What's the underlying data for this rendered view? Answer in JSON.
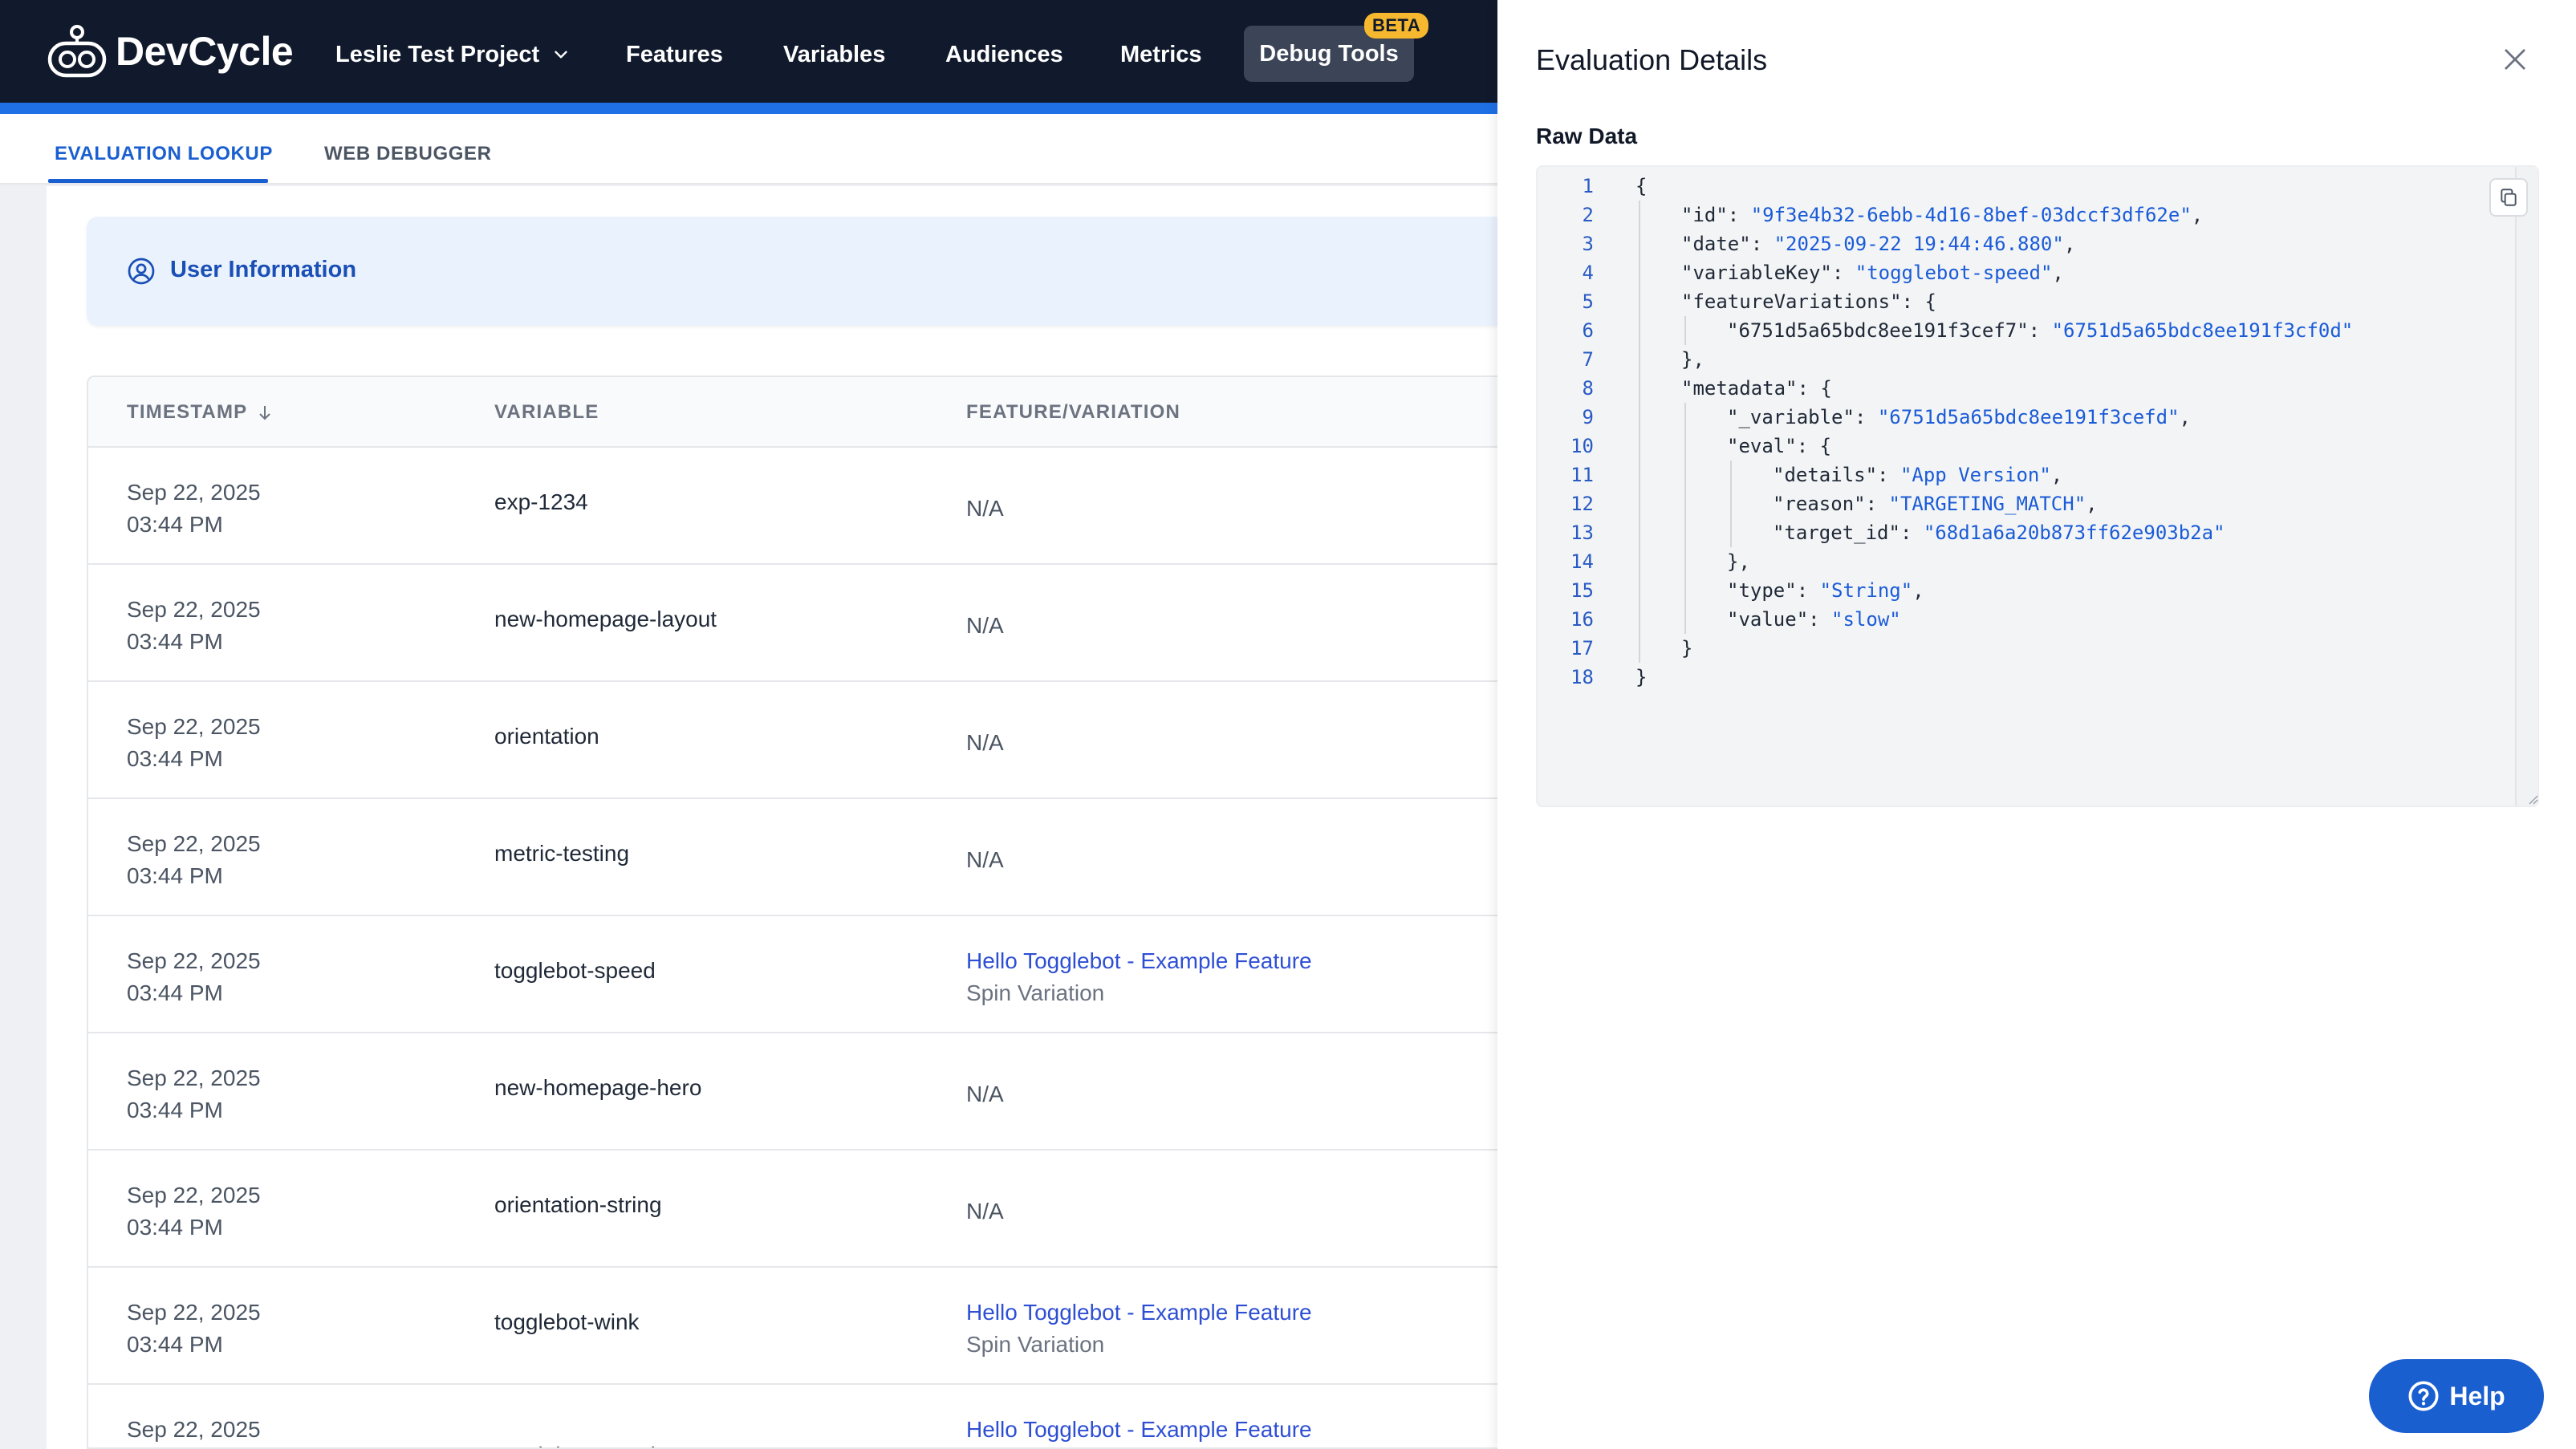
{
  "app": {
    "logo_text": "DevCycle"
  },
  "nav": {
    "project": "Leslie Test Project",
    "items": [
      "Features",
      "Variables",
      "Audiences",
      "Metrics"
    ],
    "active": "Debug Tools",
    "badge": "BETA"
  },
  "subtabs": [
    "EVALUATION LOOKUP",
    "WEB DEBUGGER"
  ],
  "user_info": {
    "label": "User Information"
  },
  "table": {
    "headers": [
      "TIMESTAMP",
      "VARIABLE",
      "FEATURE/VARIATION"
    ],
    "rows": [
      {
        "date": "Sep 22, 2025",
        "time": "03:44 PM",
        "variable": "exp-1234",
        "feature": "N/A",
        "variation": ""
      },
      {
        "date": "Sep 22, 2025",
        "time": "03:44 PM",
        "variable": "new-homepage-layout",
        "feature": "N/A",
        "variation": ""
      },
      {
        "date": "Sep 22, 2025",
        "time": "03:44 PM",
        "variable": "orientation",
        "feature": "N/A",
        "variation": ""
      },
      {
        "date": "Sep 22, 2025",
        "time": "03:44 PM",
        "variable": "metric-testing",
        "feature": "N/A",
        "variation": ""
      },
      {
        "date": "Sep 22, 2025",
        "time": "03:44 PM",
        "variable": "togglebot-speed",
        "feature": "Hello Togglebot - Example Feature",
        "variation": "Spin Variation"
      },
      {
        "date": "Sep 22, 2025",
        "time": "03:44 PM",
        "variable": "new-homepage-hero",
        "feature": "N/A",
        "variation": ""
      },
      {
        "date": "Sep 22, 2025",
        "time": "03:44 PM",
        "variable": "orientation-string",
        "feature": "N/A",
        "variation": ""
      },
      {
        "date": "Sep 22, 2025",
        "time": "03:44 PM",
        "variable": "togglebot-wink",
        "feature": "Hello Togglebot - Example Feature",
        "variation": "Spin Variation"
      },
      {
        "date": "Sep 22, 2025",
        "time": "",
        "variable": "togglebot-speed",
        "feature": "Hello Togglebot - Example Feature",
        "variation": ""
      }
    ]
  },
  "drawer": {
    "title": "Evaluation Details",
    "raw_label": "Raw Data",
    "code_lines": [
      {
        "indent": 0,
        "text": "{",
        "key": "",
        "val": ""
      },
      {
        "indent": 1,
        "key": "\"id\"",
        "val": "\"9f3e4b32-6ebb-4d16-8bef-03dccf3df62e\"",
        "tail": ","
      },
      {
        "indent": 1,
        "key": "\"date\"",
        "val": "\"2025-09-22 19:44:46.880\"",
        "tail": ","
      },
      {
        "indent": 1,
        "key": "\"variableKey\"",
        "val": "\"togglebot-speed\"",
        "tail": ","
      },
      {
        "indent": 1,
        "key": "\"featureVariations\"",
        "val": "",
        "tail": "{"
      },
      {
        "indent": 2,
        "key": "\"6751d5a65bdc8ee191f3cef7\"",
        "val": "\"6751d5a65bdc8ee191f3cf0d\"",
        "tail": ""
      },
      {
        "indent": 1,
        "text": "},",
        "key": "",
        "val": ""
      },
      {
        "indent": 1,
        "key": "\"metadata\"",
        "val": "",
        "tail": "{"
      },
      {
        "indent": 2,
        "key": "\"_variable\"",
        "val": "\"6751d5a65bdc8ee191f3cefd\"",
        "tail": ","
      },
      {
        "indent": 2,
        "key": "\"eval\"",
        "val": "",
        "tail": "{"
      },
      {
        "indent": 3,
        "key": "\"details\"",
        "val": "\"App Version\"",
        "tail": ","
      },
      {
        "indent": 3,
        "key": "\"reason\"",
        "val": "\"TARGETING_MATCH\"",
        "tail": ","
      },
      {
        "indent": 3,
        "key": "\"target_id\"",
        "val": "\"68d1a6a20b873ff62e903b2a\"",
        "tail": ""
      },
      {
        "indent": 2,
        "text": "},",
        "key": "",
        "val": ""
      },
      {
        "indent": 2,
        "key": "\"type\"",
        "val": "\"String\"",
        "tail": ","
      },
      {
        "indent": 2,
        "key": "\"value\"",
        "val": "\"slow\"",
        "tail": ""
      },
      {
        "indent": 1,
        "text": "}",
        "key": "",
        "val": ""
      },
      {
        "indent": 0,
        "text": "}",
        "key": "",
        "val": ""
      }
    ]
  },
  "help": {
    "label": "Help"
  },
  "colors": {
    "nav_bg": "#111a2c",
    "accent": "#1a5fd0",
    "beta": "#f5b82e",
    "link": "#2e4fd4"
  }
}
